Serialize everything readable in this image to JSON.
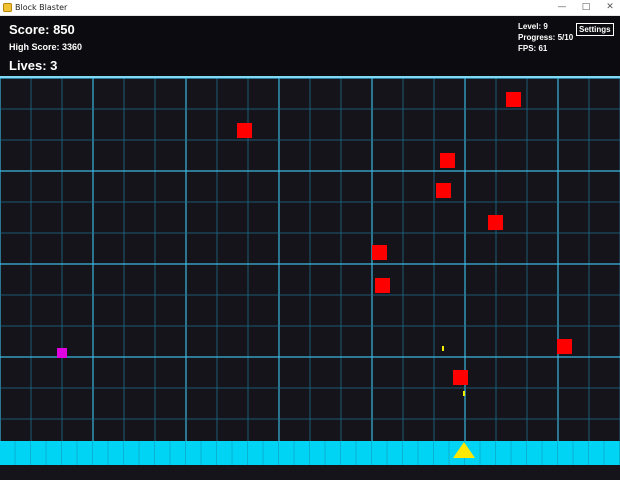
{
  "window": {
    "title": "Block Blaster",
    "icon": "app-icon",
    "controls": {
      "minimize": "—",
      "maximize": "□",
      "close": "✕"
    }
  },
  "hud": {
    "score": "Score: 850",
    "high_score": "High Score: 3360",
    "lives": "Lives: 3",
    "level": "Level: 9",
    "progress": "Progress: 5/10",
    "fps": "FPS: 61",
    "settings_label": "Settings"
  },
  "colors": {
    "background": "#15141a",
    "hud_background": "#0c0c10",
    "grid_major": "#3db6e0",
    "grid_minor": "#1d6f8f",
    "hud_divider": "#7fd9f2",
    "enemy_block": "#ff0000",
    "faded_block": "#3a1418",
    "powerup": "#e000e0",
    "player_ship": "#ffe800",
    "bullet": "#f0f000",
    "floor": "#00d4f5"
  }
}
